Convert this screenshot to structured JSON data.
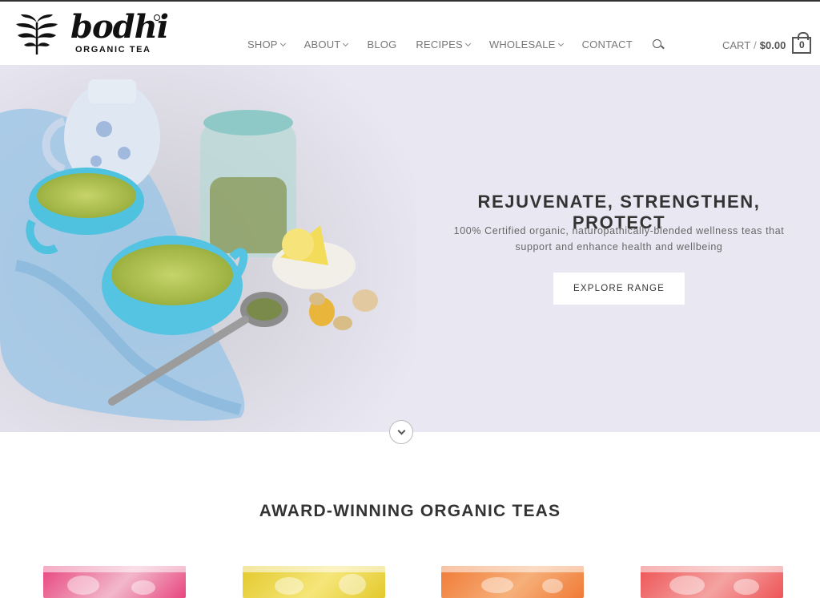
{
  "brand": {
    "name": "bodhi",
    "tagline": "ORGANIC TEA"
  },
  "nav": {
    "items": [
      {
        "label": "SHOP",
        "dropdown": true
      },
      {
        "label": "ABOUT",
        "dropdown": true
      },
      {
        "label": "BLOG",
        "dropdown": false
      },
      {
        "label": "RECIPES",
        "dropdown": true
      },
      {
        "label": "WHOLESALE",
        "dropdown": true
      },
      {
        "label": "CONTACT",
        "dropdown": false
      }
    ],
    "search_icon": "search-icon"
  },
  "cart": {
    "label": "CART",
    "separator": "/",
    "total": "$0.00",
    "count": "0"
  },
  "hero": {
    "title": "REJUVENATE, STRENGTHEN, PROTECT",
    "subtitle": "100% Certified organic, naturopathically-blended wellness teas that support and enhance health and wellbeing",
    "button_label": "EXPLORE RANGE",
    "background_color": "#e9e7f2"
  },
  "section": {
    "title": "AWARD-WINNING ORGANIC TEAS"
  },
  "products": [
    {
      "color": "#e8457e",
      "accent": "#f2b8cb"
    },
    {
      "color": "#e3c92b",
      "accent": "#f5e67a"
    },
    {
      "color": "#f07a36",
      "accent": "#f6b07a"
    },
    {
      "color": "#ee5456",
      "accent": "#f4a3a2"
    }
  ]
}
